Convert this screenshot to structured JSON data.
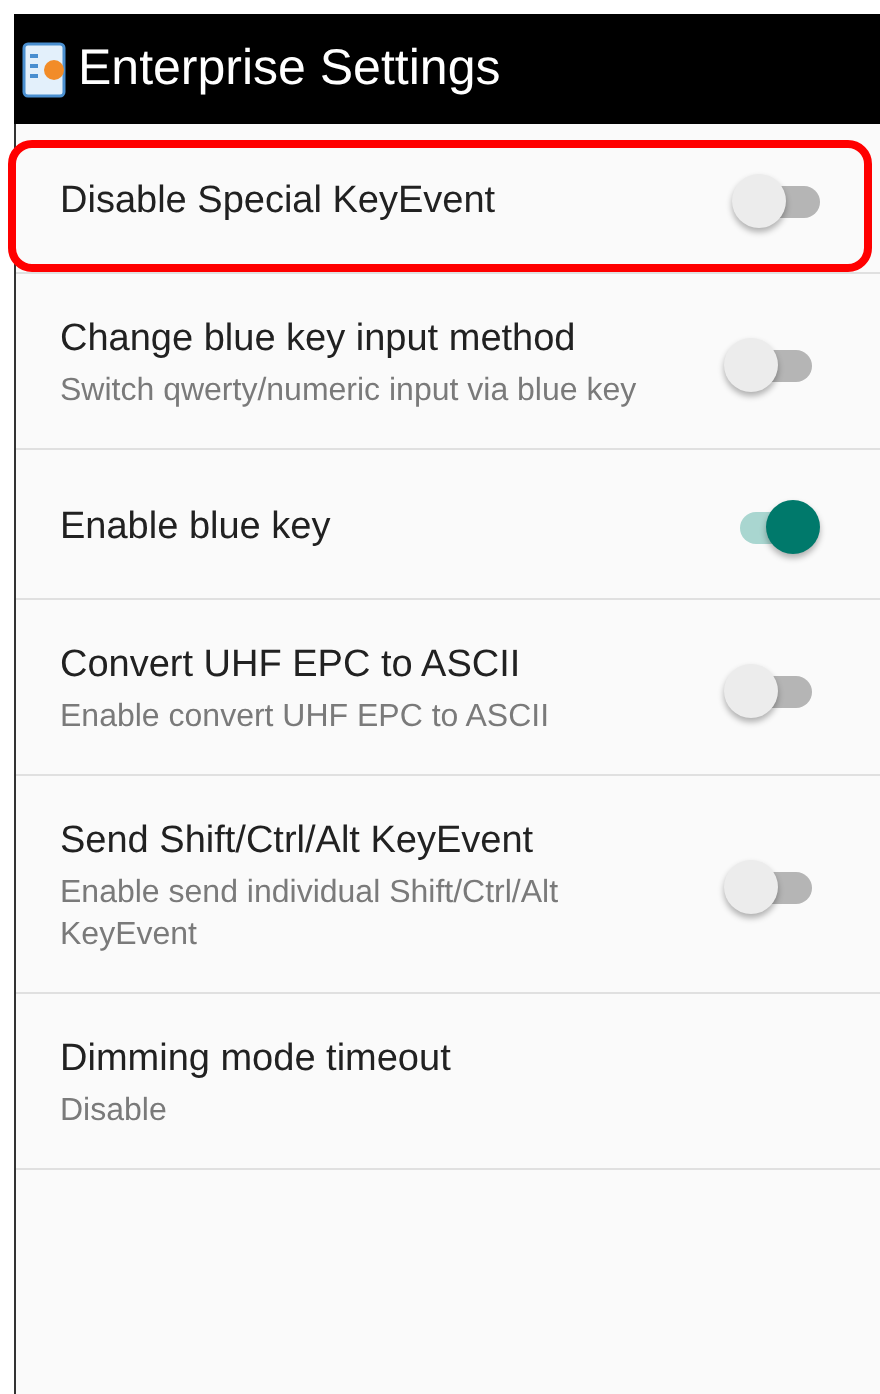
{
  "app_bar": {
    "title": "Enterprise Settings"
  },
  "settings": [
    {
      "title": "Disable Special KeyEvent",
      "kind": "switch",
      "on": false,
      "highlighted": true
    },
    {
      "title": "Change blue key input method",
      "summary": "Switch qwerty/numeric input via blue key",
      "kind": "switch",
      "on": false,
      "highlighted": false
    },
    {
      "title": "Enable blue key",
      "kind": "switch",
      "on": true,
      "highlighted": false
    },
    {
      "title": "Convert UHF EPC to ASCII",
      "summary": "Enable convert UHF EPC to ASCII",
      "kind": "switch",
      "on": false,
      "highlighted": false
    },
    {
      "title": "Send Shift/Ctrl/Alt KeyEvent",
      "summary": "Enable send individual Shift/Ctrl/Alt KeyEvent",
      "kind": "switch",
      "on": false,
      "highlighted": false
    },
    {
      "title": "Dimming mode timeout",
      "summary": "Disable",
      "kind": "text",
      "highlighted": false
    },
    {
      "kind": "cut"
    }
  ]
}
